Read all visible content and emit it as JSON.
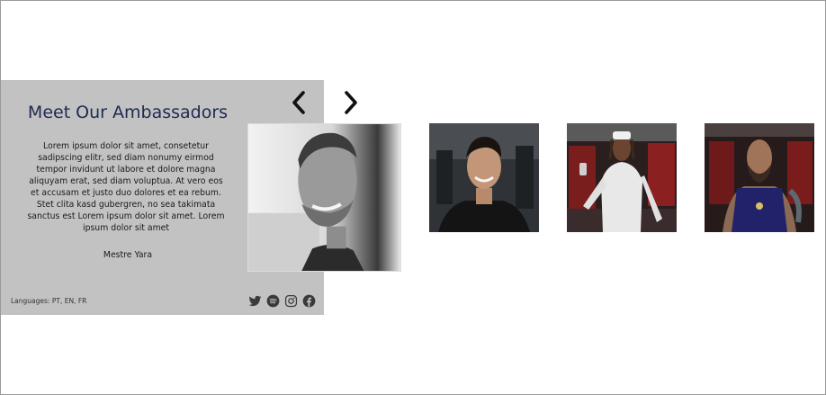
{
  "ambassadors": {
    "title": "Meet Our Ambassadors",
    "description": "Lorem ipsum dolor sit amet, consetetur sadipscing elitr, sed diam nonumy eirmod tempor invidunt ut labore et dolore magna aliquyam erat, sed diam voluptua. At vero eos et accusam et justo duo dolores et ea rebum. Stet clita kasd gubergren, no sea takimata sanctus est Lorem ipsum dolor sit amet. Lorem ipsum dolor sit amet",
    "name": "Mestre Yara",
    "languages": "Languages: PT, EN, FR"
  },
  "socials": [
    "twitter-icon",
    "spotify-icon",
    "instagram-icon",
    "facebook-icon"
  ],
  "navigation": {
    "prev_icon": "chevron-left-icon",
    "next_icon": "chevron-right-icon"
  },
  "colors": {
    "panel_bg": "#c2c2c2",
    "title": "#1d2a52",
    "icon": "#3a3a3a"
  }
}
